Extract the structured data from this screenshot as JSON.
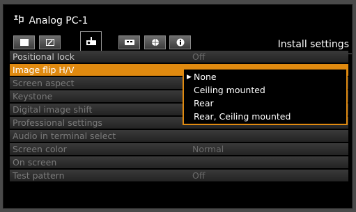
{
  "source": {
    "icon": "analog-input-icon",
    "title": "Analog PC-1"
  },
  "tabs": [
    {
      "icon": "image-adjust-icon",
      "active": false
    },
    {
      "icon": "edit-icon",
      "active": false
    },
    {
      "icon": "projector-install-icon",
      "active": true
    },
    {
      "icon": "remote-control-icon",
      "active": false
    },
    {
      "icon": "network-icon",
      "active": false
    },
    {
      "icon": "info-icon",
      "active": false
    }
  ],
  "section_title": "Install settings",
  "menu": [
    {
      "label": "Positional lock",
      "value": "Off"
    },
    {
      "label": "Image flip H/V",
      "value": ""
    },
    {
      "label": "Screen aspect",
      "value": ""
    },
    {
      "label": "Keystone",
      "value": ""
    },
    {
      "label": "Digital image shift",
      "value": ""
    },
    {
      "label": "Professional settings",
      "value": ""
    },
    {
      "label": "Audio in terminal select",
      "value": ""
    },
    {
      "label": "Screen color",
      "value": "Normal"
    },
    {
      "label": "On screen",
      "value": ""
    },
    {
      "label": "Test pattern",
      "value": "Off"
    }
  ],
  "dropdown": {
    "selected": "None",
    "options": [
      "None",
      "Ceiling mounted",
      "Rear",
      "Rear, Ceiling mounted"
    ]
  },
  "colors": {
    "highlight": "#e08a10",
    "background": "#000000"
  }
}
